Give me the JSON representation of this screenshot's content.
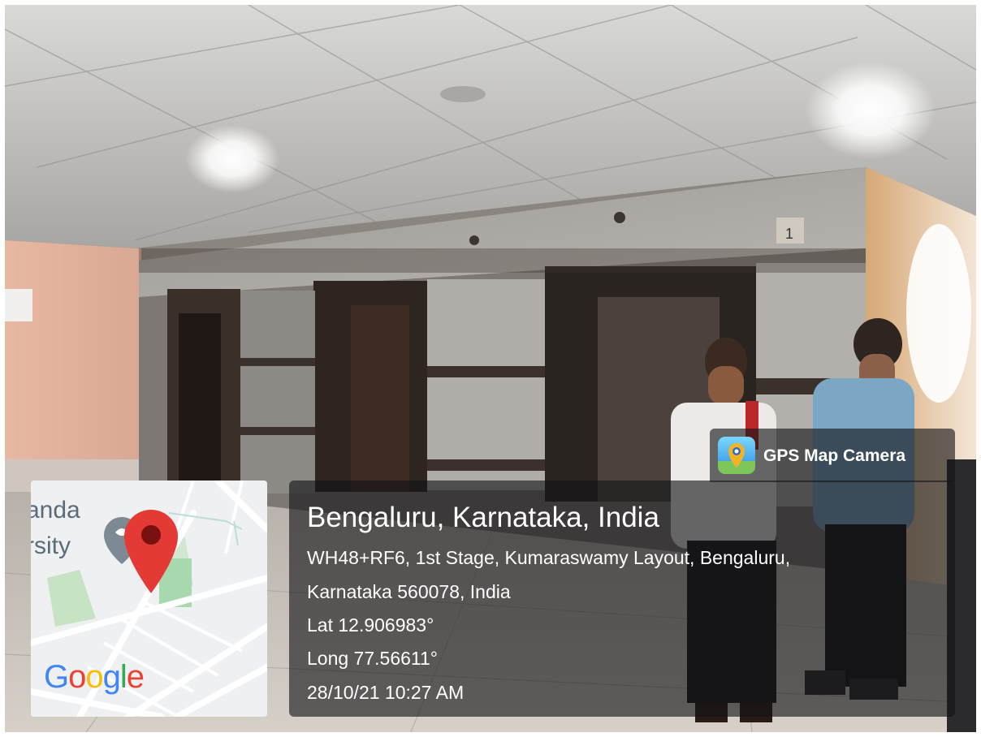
{
  "map": {
    "place_text_line1": "anda",
    "place_text_line2": "rsity",
    "logo_text": "Google",
    "pin_icon": "map-pin-icon",
    "colors": {
      "pin_red": "#e53935",
      "pin_dark": "#7a1111",
      "google_blue": "#4285F4",
      "google_red": "#EA4335",
      "google_yellow": "#FBBC05",
      "google_green": "#34A853"
    }
  },
  "badge": {
    "app_name": "GPS Map Camera",
    "icon": "gps-map-camera-icon"
  },
  "location": {
    "city": "Bengaluru, Karnataka, India",
    "address_line1": "WH48+RF6, 1st Stage, Kumaraswamy Layout, Bengaluru,",
    "address_line2": "Karnataka 560078, India",
    "latitude": "Lat 12.906983°",
    "longitude": "Long 77.56611°",
    "timestamp": "28/10/21 10:27 AM"
  }
}
